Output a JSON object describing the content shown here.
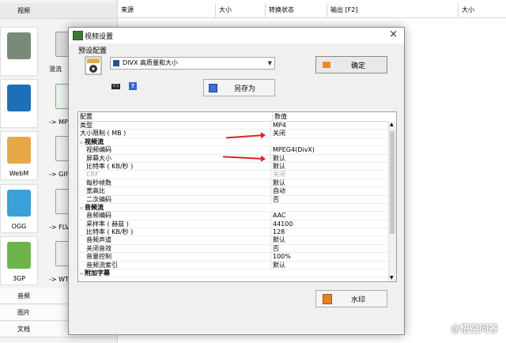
{
  "sidebar": {
    "header_label": "视频",
    "formats": [
      "WebM",
      "OGG",
      "3GP"
    ],
    "convert_targets": [
      "混流",
      "-> MP",
      "-> GIF",
      "-> FLV",
      "-> WT"
    ],
    "categories": [
      "音频",
      "图片",
      "文档"
    ]
  },
  "file_list": {
    "columns": [
      "来源",
      "大小",
      "转换状态",
      "输出 [F2]",
      "大小"
    ]
  },
  "dialog": {
    "title": "视频设置",
    "preset_label": "预设配置",
    "preset_value": "DIVX 高质量和大小",
    "ok_button": "确定",
    "save_as_button": "另存为",
    "watermark_button": "水印",
    "grid": {
      "header_key": "配置",
      "header_value": "数值",
      "rows": [
        {
          "key": "类型",
          "value": "MP4",
          "kind": "item"
        },
        {
          "key": "大小限制 ( MB )",
          "value": "关闭",
          "kind": "item"
        },
        {
          "key": "视频流",
          "value": "",
          "kind": "section"
        },
        {
          "key": "视频编码",
          "value": "MPEG4(DivX)",
          "kind": "sub"
        },
        {
          "key": "屏幕大小",
          "value": "默认",
          "kind": "sub"
        },
        {
          "key": "比特率 ( KB/秒 )",
          "value": "默认",
          "kind": "sub"
        },
        {
          "key": "CRF",
          "value": "关闭",
          "kind": "disabled"
        },
        {
          "key": "每秒帧数",
          "value": "默认",
          "kind": "sub"
        },
        {
          "key": "宽高比",
          "value": "自动",
          "kind": "sub"
        },
        {
          "key": "二次编码",
          "value": "否",
          "kind": "sub"
        },
        {
          "key": "音频流",
          "value": "",
          "kind": "section"
        },
        {
          "key": "音频编码",
          "value": "AAC",
          "kind": "sub"
        },
        {
          "key": "采样率 ( 赫兹 )",
          "value": "44100",
          "kind": "sub"
        },
        {
          "key": "比特率 ( KB/秒 )",
          "value": "128",
          "kind": "sub"
        },
        {
          "key": "音频声道",
          "value": "默认",
          "kind": "sub"
        },
        {
          "key": "关闭音效",
          "value": "否",
          "kind": "sub"
        },
        {
          "key": "音量控制",
          "value": "100%",
          "kind": "sub"
        },
        {
          "key": "音频流索引",
          "value": "默认",
          "kind": "sub"
        },
        {
          "key": "附加字幕",
          "value": "",
          "kind": "section"
        }
      ]
    }
  },
  "watermark_text": "@悟空问答",
  "colors": {
    "annotation_arrow": "#e02020",
    "ok_icon": "#f08a24",
    "accent_blue": "#3b6fd1"
  }
}
